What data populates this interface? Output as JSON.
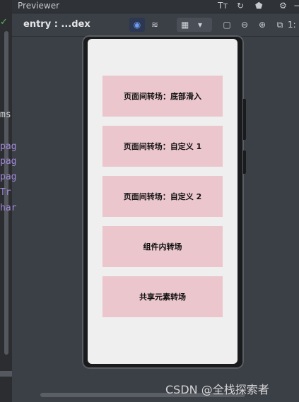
{
  "window": {
    "title": "Previewer",
    "header_icons": [
      "font-size-icon",
      "refresh-icon",
      "inspect-icon",
      "settings-icon",
      "minimize-icon"
    ]
  },
  "toolbar": {
    "entry_label": "entry : ...dex",
    "buttons": [
      "view-icon",
      "layers-icon",
      "grid-icon",
      "dropdown-icon",
      "crop-icon",
      "zoom-out-icon",
      "zoom-in-icon",
      "fit-icon",
      "ratio-icon"
    ],
    "ratio_label": "1:"
  },
  "editor": {
    "fragments": [
      "ms",
      "pag",
      "pag",
      "pag",
      "Tr",
      "har"
    ]
  },
  "screen": {
    "buttons": [
      "页面间转场：底部滑入",
      "页面间转场：自定义 1",
      "页面间转场：自定义 2",
      "组件内转场",
      "共享元素转场"
    ]
  },
  "watermark": "CSDN @全栈探索者"
}
